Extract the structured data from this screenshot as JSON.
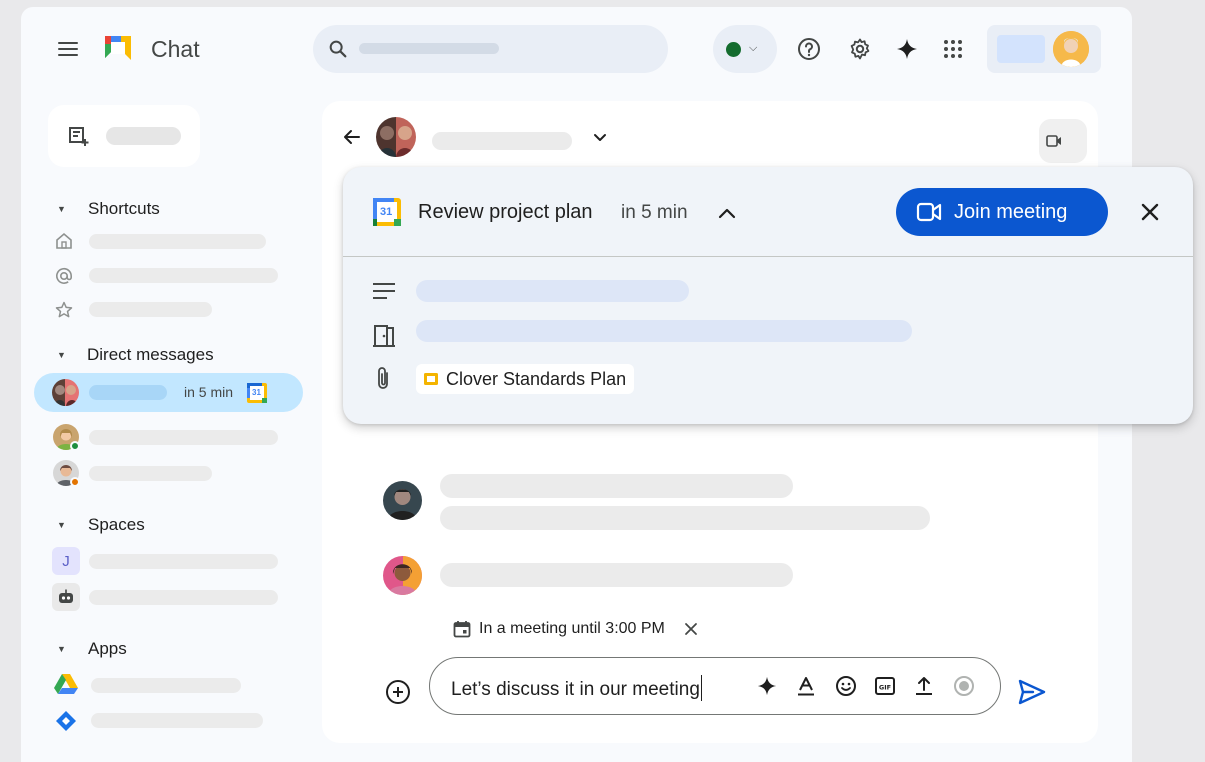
{
  "app": {
    "title": "Chat"
  },
  "sidebar": {
    "sections": {
      "shortcuts": "Shortcuts",
      "direct_messages": "Direct messages",
      "spaces": "Spaces",
      "apps": "Apps"
    },
    "active_dm_time": "in 5 min",
    "calendar_day": "31",
    "space_initial": "J"
  },
  "card": {
    "title": "Review project plan",
    "time": "in 5 min",
    "join_label": "Join meeting",
    "calendar_day": "31",
    "attachment": "Clover Standards Plan"
  },
  "status_note": "In a meeting until 3:00 PM",
  "composer": {
    "text": "Let’s discuss it in our meeting"
  },
  "colors": {
    "accent": "#0b57d0",
    "active_dm": "#c2e7ff",
    "status_online": "#146c2e"
  }
}
